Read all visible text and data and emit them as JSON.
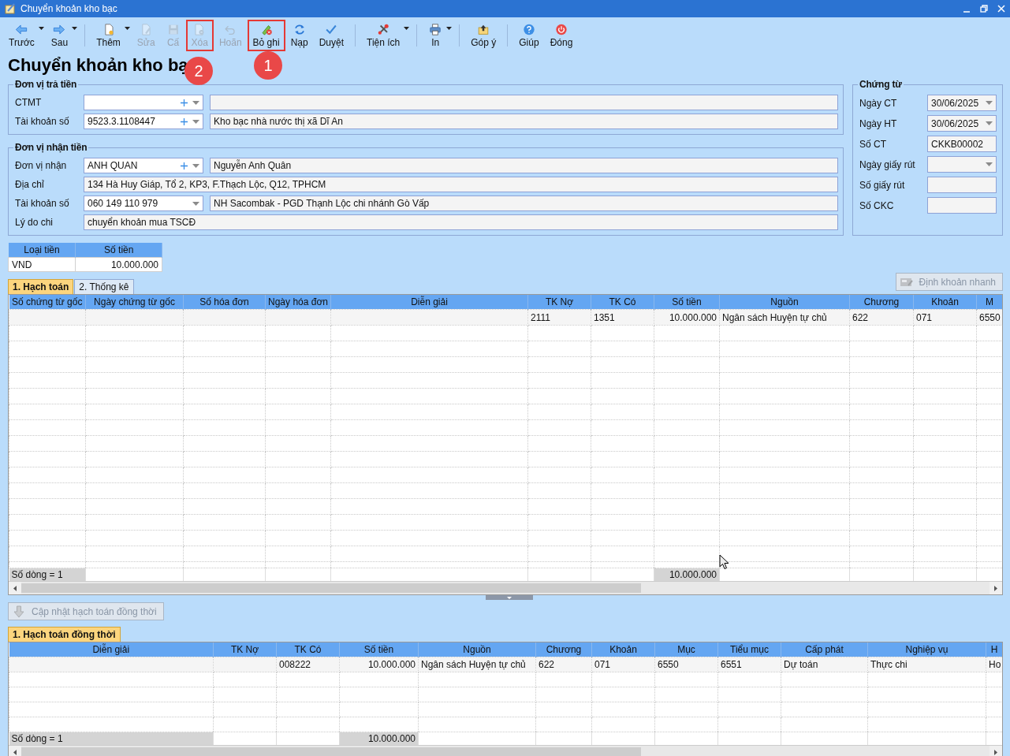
{
  "window": {
    "title": "Chuyển khoản kho bạc"
  },
  "toolbar": [
    {
      "kind": "button",
      "label": "Trước",
      "dropdown": true,
      "disabled": false,
      "highlighted": false
    },
    {
      "kind": "button",
      "label": "Sau",
      "dropdown": true,
      "disabled": false,
      "highlighted": false
    },
    {
      "kind": "separator"
    },
    {
      "kind": "button",
      "label": "Thêm",
      "dropdown": true,
      "disabled": false,
      "highlighted": false
    },
    {
      "kind": "button",
      "label": "Sửa",
      "dropdown": false,
      "disabled": true,
      "highlighted": false
    },
    {
      "kind": "button",
      "label": "Cấ",
      "dropdown": false,
      "disabled": true,
      "highlighted": false
    },
    {
      "kind": "button",
      "label": "Xóa",
      "dropdown": false,
      "disabled": true,
      "highlighted": true
    },
    {
      "kind": "button",
      "label": "Hoãn",
      "dropdown": false,
      "disabled": true,
      "highlighted": false
    },
    {
      "kind": "button",
      "label": "Bỏ ghi",
      "dropdown": false,
      "disabled": false,
      "highlighted": true
    },
    {
      "kind": "button",
      "label": "Nạp",
      "dropdown": false,
      "disabled": false,
      "highlighted": false
    },
    {
      "kind": "button",
      "label": "Duyệt",
      "dropdown": false,
      "disabled": false,
      "highlighted": false
    },
    {
      "kind": "separator"
    },
    {
      "kind": "button",
      "label": "Tiện ích",
      "dropdown": true,
      "disabled": false,
      "highlighted": false
    },
    {
      "kind": "separator"
    },
    {
      "kind": "button",
      "label": "In",
      "dropdown": true,
      "disabled": false,
      "highlighted": false
    },
    {
      "kind": "separator"
    },
    {
      "kind": "button",
      "label": "Góp ý",
      "dropdown": false,
      "disabled": false,
      "highlighted": false
    },
    {
      "kind": "separator"
    },
    {
      "kind": "button",
      "label": "Giúp",
      "dropdown": false,
      "disabled": false,
      "highlighted": false
    },
    {
      "kind": "button",
      "label": "Đóng",
      "dropdown": false,
      "disabled": false,
      "highlighted": false
    }
  ],
  "heading": "Chuyển khoản kho bạ",
  "callouts": [
    {
      "label": "1"
    },
    {
      "label": "2"
    }
  ],
  "payer": {
    "title": "Đơn vị trả tiền",
    "rows": [
      {
        "kind": "combo",
        "label": "CTMT",
        "add": true
      },
      {
        "kind": "combo",
        "label": "Tài khoản số",
        "value": "9523.3.1108447",
        "add": true,
        "name": "Kho bạc nhà nước thị xã Dĩ An"
      }
    ]
  },
  "recipient": {
    "title": "Đơn vị nhận tiền",
    "rows": [
      {
        "kind": "combo",
        "label": "Đơn vị nhận",
        "value": "ANH QUAN",
        "add": true,
        "name": "Nguyễn Anh Quân"
      },
      {
        "kind": "text",
        "label": "Địa chỉ",
        "value": "134 Hà Huy Giáp, Tổ 2, KP3, F.Thạch Lộc, Q12, TPHCM"
      },
      {
        "kind": "combo",
        "label": "Tài khoản số",
        "value": "060 149 110 979",
        "add": false,
        "name": "NH Sacombak - PGD Thạnh Lộc chi nhánh Gò Vấp"
      },
      {
        "kind": "text",
        "label": "Lý do chi",
        "value": "chuyển khoản mua TSCĐ"
      }
    ]
  },
  "voucher": {
    "title": "Chứng từ",
    "fields": [
      {
        "label": "Ngày CT",
        "value": "30/06/2025",
        "dropdown": true
      },
      {
        "label": "Ngày HT",
        "value": "30/06/2025",
        "dropdown": true
      },
      {
        "label": "Số CT",
        "value": "CKKB00002",
        "dropdown": false
      },
      {
        "label": "Ngày giấy rút",
        "dropdown": true
      },
      {
        "label": "Số giấy rút",
        "dropdown": false
      },
      {
        "label": "Số CKC",
        "dropdown": false
      }
    ]
  },
  "currency_table": {
    "columns": [
      "Loại tiền",
      "Số tiền"
    ],
    "rows": [
      [
        "VND",
        "10.000.000"
      ]
    ]
  },
  "tabs": [
    {
      "label": "1. Hạch toán",
      "selected": true
    },
    {
      "label": "2. Thống kê",
      "selected": false
    }
  ],
  "quick_entry_button": {
    "label": "Định khoản nhanh",
    "disabled": true
  },
  "entries_grid": {
    "columns": [
      {
        "label": "Số chứng từ gốc",
        "kind": "text"
      },
      {
        "label": "Ngày chứng từ gốc",
        "kind": "text"
      },
      {
        "label": "Số hóa đơn",
        "kind": "text"
      },
      {
        "label": "Ngày hóa đơn",
        "kind": "text"
      },
      {
        "label": "Diễn giải",
        "kind": "text"
      },
      {
        "label": "TK Nợ",
        "kind": "text"
      },
      {
        "label": "TK Có",
        "kind": "text"
      },
      {
        "label": "Số tiền",
        "kind": "amount"
      },
      {
        "label": "Nguồn",
        "kind": "text"
      },
      {
        "label": "Chương",
        "kind": "text"
      },
      {
        "label": "Khoản",
        "kind": "text"
      },
      {
        "label": "M",
        "kind": "text"
      }
    ],
    "rows": [
      [
        null,
        null,
        null,
        null,
        null,
        "2111",
        "1351",
        "10.000.000",
        "Ngân sách Huyện tự chủ",
        "622",
        "071",
        "6550"
      ]
    ],
    "footer": {
      "count": "Số dòng = 1",
      "total": "10.000.000"
    }
  },
  "sync_button": {
    "label": "Cập nhật hạch toán đồng thời",
    "disabled": true
  },
  "sync_tabs": [
    {
      "label": "1. Hạch toán đồng thời",
      "selected": true
    }
  ],
  "sync_grid": {
    "columns": [
      {
        "label": "Diễn giải",
        "kind": "text"
      },
      {
        "label": "TK Nợ",
        "kind": "text"
      },
      {
        "label": "TK Có",
        "kind": "text"
      },
      {
        "label": "Số tiền",
        "kind": "amount"
      },
      {
        "label": "Nguồn",
        "kind": "text"
      },
      {
        "label": "Chương",
        "kind": "text"
      },
      {
        "label": "Khoản",
        "kind": "text"
      },
      {
        "label": "Mục",
        "kind": "text"
      },
      {
        "label": "Tiểu mục",
        "kind": "text"
      },
      {
        "label": "Cấp phát",
        "kind": "text"
      },
      {
        "label": "Nghiệp vụ",
        "kind": "text"
      },
      {
        "label": "H",
        "kind": "text"
      }
    ],
    "rows": [
      [
        null,
        null,
        "008222",
        "10.000.000",
        "Ngân sách Huyện tự chủ",
        "622",
        "071",
        "6550",
        "6551",
        "Dự toán",
        "Thực chi",
        "Ho"
      ]
    ],
    "footer": {
      "count": "Số dòng = 1",
      "total": "10.000.000"
    }
  }
}
